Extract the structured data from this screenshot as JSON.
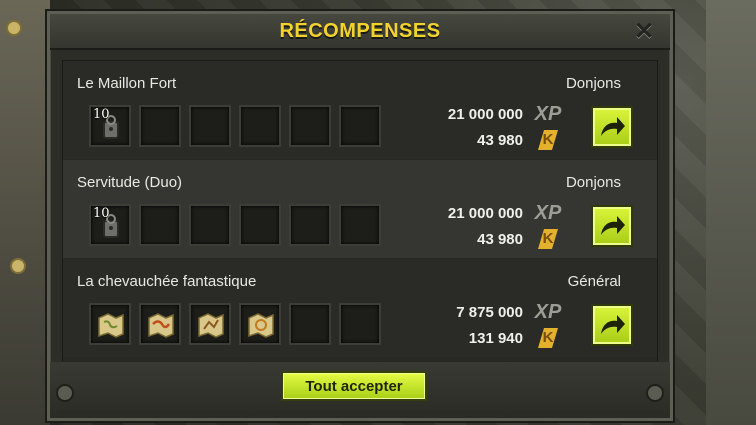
{
  "window": {
    "title": "RÉCOMPENSES",
    "close_label": "✕"
  },
  "rows": [
    {
      "name": "Le Maillon Fort",
      "category": "Donjons",
      "first_slot_qty": "10",
      "xp": "21 000 000",
      "kamas": "43 980",
      "xp_label": "XP",
      "kamas_label": "K"
    },
    {
      "name": "Servitude (Duo)",
      "category": "Donjons",
      "first_slot_qty": "10",
      "xp": "21 000 000",
      "kamas": "43 980",
      "xp_label": "XP",
      "kamas_label": "K"
    },
    {
      "name": "La chevauchée fantastique",
      "category": "Général",
      "xp": "7 875 000",
      "kamas": "131 940",
      "xp_label": "XP",
      "kamas_label": "K"
    }
  ],
  "footer": {
    "accept_all_label": "Tout accepter"
  },
  "colors": {
    "accent": "#f2d32d",
    "button": "#c6e22b",
    "panel": "#2c2d27"
  },
  "icons": {
    "close": "close-icon",
    "claim": "arrow-curve-icon",
    "item_key": "key-item-icon",
    "item_map": "treasure-map-icon"
  }
}
